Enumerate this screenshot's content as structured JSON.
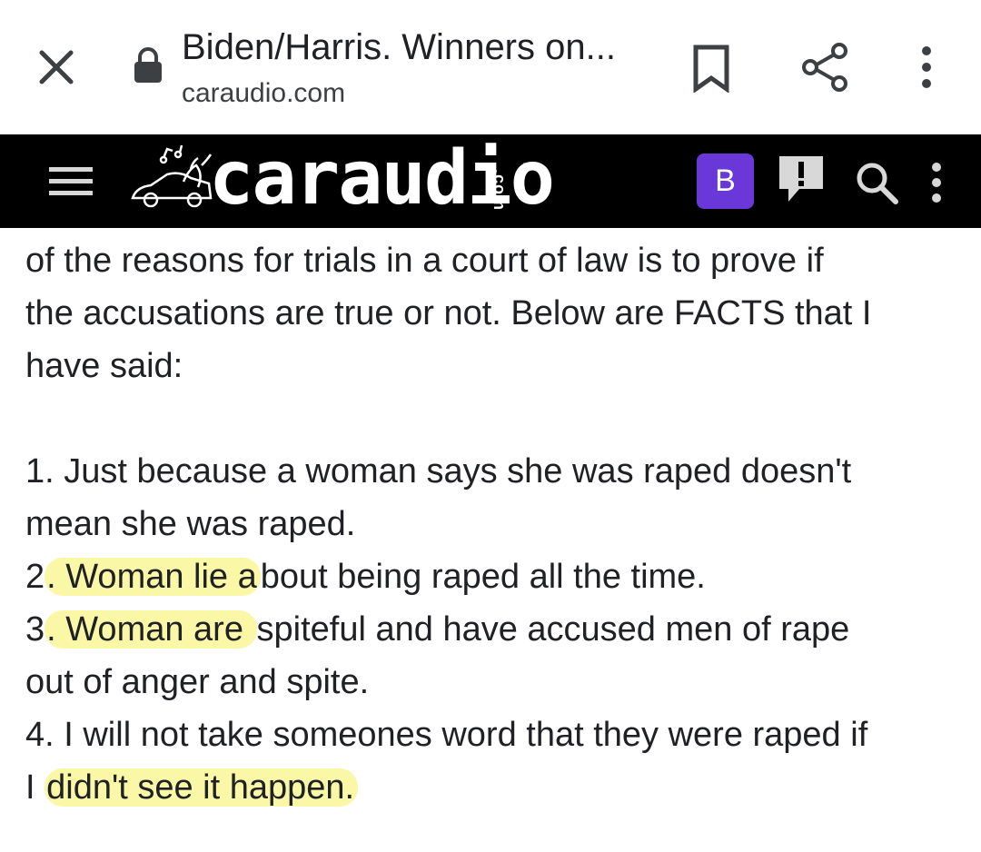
{
  "browser": {
    "page_title": "Biden/Harris. Winners on...",
    "domain": "caraudio.com"
  },
  "site_header": {
    "logo_text": "caraudio",
    "logo_suffix": ".com",
    "logo_tm": "TM",
    "avatar_letter": "B",
    "accent_color": "#6a38d8"
  },
  "post": {
    "intro_lines": [
      "of the reasons for trials in a court of law is to prove if",
      "the accusations are true or not. Below are FACTS that I",
      "have said:"
    ],
    "items": [
      {
        "line1": "1. Just because a woman says she was raped doesn't",
        "line2": "mean she was raped."
      },
      {
        "num": "2",
        "highlight": ". Woman lie a",
        "rest": "bout being raped all the time."
      },
      {
        "num": "3",
        "highlight": ". Woman are ",
        "rest": "spiteful and have accused men of rape",
        "line2": "out of anger and spite."
      },
      {
        "line1": "4. I will not take someones word that they were raped if",
        "prefix": "I ",
        "highlight": "didn't see it happen."
      }
    ],
    "highlight_color": "#f5f05c"
  },
  "icons": [
    "close-icon",
    "lock-icon",
    "bookmark-icon",
    "share-icon",
    "more-vert-icon",
    "hamburger-icon",
    "logo-car-icon",
    "alert-icon",
    "search-icon"
  ]
}
